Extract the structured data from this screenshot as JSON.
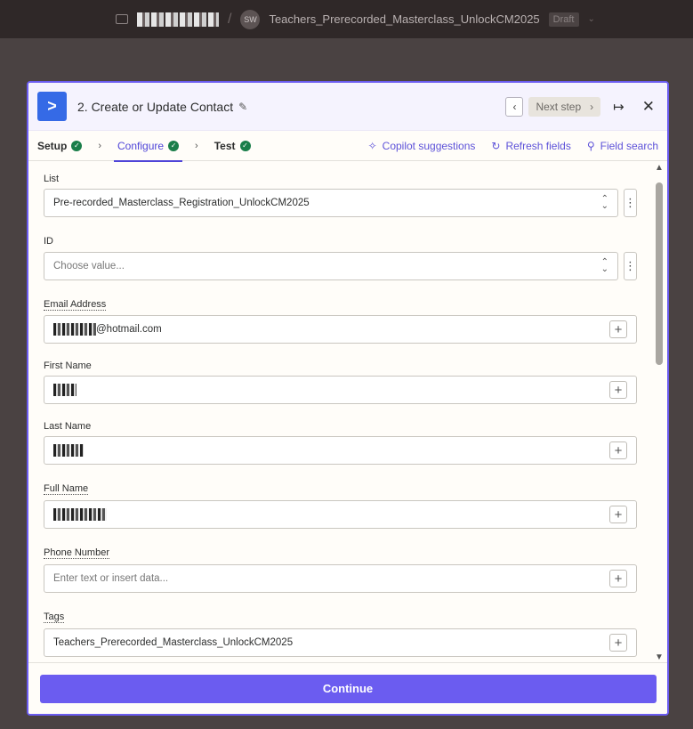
{
  "topbar": {
    "avatar_initials": "SW",
    "zap_name": "Teachers_Prerecorded_Masterclass_UnlockCM2025",
    "status_badge": "Draft"
  },
  "modal": {
    "step_title": "2. Create or Update Contact",
    "next_step_label": "Next step",
    "tabs": [
      {
        "label": "Setup",
        "status": "complete"
      },
      {
        "label": "Configure",
        "status": "complete",
        "active": true
      },
      {
        "label": "Test",
        "status": "complete"
      }
    ],
    "actions": {
      "copilot": "Copilot suggestions",
      "refresh": "Refresh fields",
      "search": "Field search"
    },
    "fields": {
      "list": {
        "label": "List",
        "value": "Pre-recorded_Masterclass_Registration_UnlockCM2025"
      },
      "id": {
        "label": "ID",
        "placeholder": "Choose value..."
      },
      "email": {
        "label": "Email Address",
        "value_suffix": "@hotmail.com"
      },
      "first_name": {
        "label": "First Name"
      },
      "last_name": {
        "label": "Last Name"
      },
      "full_name": {
        "label": "Full Name"
      },
      "phone": {
        "label": "Phone Number",
        "placeholder": "Enter text or insert data..."
      },
      "tags": {
        "label": "Tags",
        "value": "Teachers_Prerecorded_Masterclass_UnlockCM2025"
      }
    },
    "continue_label": "Continue"
  },
  "colors": {
    "accent": "#6b5cf0",
    "check_green": "#1a7e4a",
    "app_logo_blue": "#356ae6"
  }
}
